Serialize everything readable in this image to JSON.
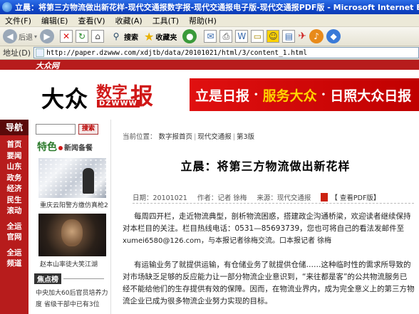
{
  "window": {
    "title": "立晨：将第三方物流做出新花样-现代交通报数字报-现代交通报电子版-现代交通报PDF版 - Microsoft Internet Explorer"
  },
  "menu": [
    "文件(F)",
    "编辑(E)",
    "查看(V)",
    "收藏(A)",
    "工具(T)",
    "帮助(H)"
  ],
  "toolbar": {
    "back": "后退",
    "search": "搜索",
    "favorites": "收藏夹"
  },
  "address": {
    "label": "地址(D)",
    "url": "http://paper.dzwww.com/xdjtb/data/20101021/html/3/content_1.html"
  },
  "site": {
    "logo": "大众网",
    "mast_title": "大众",
    "mast_digital": "数字",
    "mast_bao": "报",
    "mast_sub": "DZWWW",
    "banner_1": "立是日报",
    "banner_2": "服务大众",
    "banner_3": "日照大众日报"
  },
  "nav": {
    "header": "导航",
    "items": [
      "首页",
      "要闻",
      "山东",
      "政务",
      "经济",
      "民生",
      "滚动",
      "全运",
      "官网",
      "全运",
      "频道"
    ]
  },
  "side": {
    "search_button": "搜索",
    "special_title": "特色",
    "special_sub": "新闻备餐",
    "caption_1": "重庆云阳警方缴仿真枪2",
    "caption_2": "赵本山率徒大笑江湖",
    "focus_label": "焦点榜",
    "news_1": "中央加大60后官员培养力",
    "news_2": "度 省级干部中已有3位"
  },
  "article": {
    "crumb_prefix": "当前位置：",
    "crumb_1": "数字报首页",
    "crumb_2": "现代交通报",
    "crumb_3": "第3版",
    "title": "立晨：将第三方物流做出新花样",
    "date": "日期：20101021",
    "author": "作者：记者 徐梅",
    "source": "来源：现代交通报",
    "pdf": "【 查看PDF版】",
    "p1_l1": "每周四开栏，走近物流典型，剖析物流困惑，搭建政企沟通桥梁，欢迎读者继续保持",
    "p1_l2": "对本栏目的关注。栏目热线电话：0531—85693739，您也可将自己的看法发邮件至",
    "p1_l3": "xumei6580@126.com，与本报记者徐梅交流。口本报记者 徐梅",
    "p2_l1": "有运输业务了就提供运输，有仓储业务了就提供仓储……这种临时性的需求所导致的",
    "p2_l2": "对市场缺乏足够的反应能力让一部分物流企业意识到，“来往都是客”的公共物流服务已",
    "p2_l3": "经不能给他们的生存提供有效的保障。因而，在物流业界内，成为完全意义上的第三方物",
    "p2_l4": "流企业已成为很多物流企业努力实现的目标。"
  }
}
